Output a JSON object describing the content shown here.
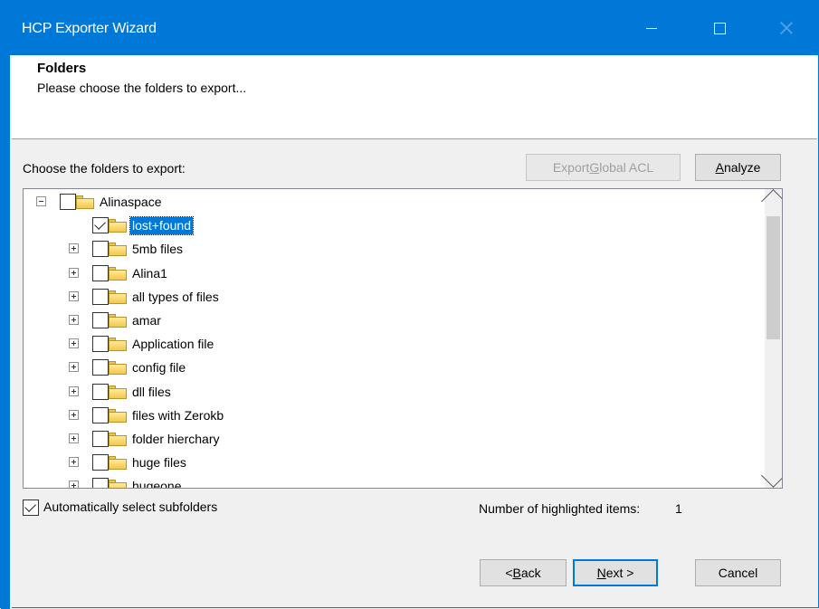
{
  "window": {
    "title": "HCP Exporter Wizard",
    "accent_color": "#0078d7"
  },
  "header": {
    "title": "Folders",
    "subtitle": "Please choose the folders to export..."
  },
  "toolbar": {
    "choose_label": "Choose the folders to export:",
    "export_acl_label_pre": "Export ",
    "export_acl_label_key": "G",
    "export_acl_label_post": "lobal ACL",
    "analyze_label_key": "A",
    "analyze_label_post": "nalyze"
  },
  "tree": {
    "root": {
      "label": "Alinaspace",
      "checked": false,
      "expanded": true
    },
    "children": [
      {
        "label": "lost+found",
        "checked": true,
        "selected": true,
        "expandable": false
      },
      {
        "label": "5mb files",
        "checked": false,
        "expandable": true
      },
      {
        "label": "Alina1",
        "checked": false,
        "expandable": true
      },
      {
        "label": "all types of files",
        "checked": false,
        "expandable": true
      },
      {
        "label": "amar",
        "checked": false,
        "expandable": true
      },
      {
        "label": "Application file",
        "checked": false,
        "expandable": true
      },
      {
        "label": "config file",
        "checked": false,
        "expandable": true
      },
      {
        "label": "dll files",
        "checked": false,
        "expandable": true
      },
      {
        "label": "files with Zerokb",
        "checked": false,
        "expandable": true
      },
      {
        "label": "folder hierchary",
        "checked": false,
        "expandable": true
      },
      {
        "label": "huge files",
        "checked": false,
        "expandable": true
      },
      {
        "label": "hugeone",
        "checked": false,
        "expandable": true
      }
    ]
  },
  "footer": {
    "auto_select_label": "Automatically select subfolders",
    "auto_select_checked": true,
    "highlighted_label": "Number of highlighted items:",
    "highlighted_count": "1",
    "back_pre": "< ",
    "back_key": "B",
    "back_post": "ack",
    "next_key": "N",
    "next_post": "ext >",
    "cancel_label": "Cancel"
  }
}
